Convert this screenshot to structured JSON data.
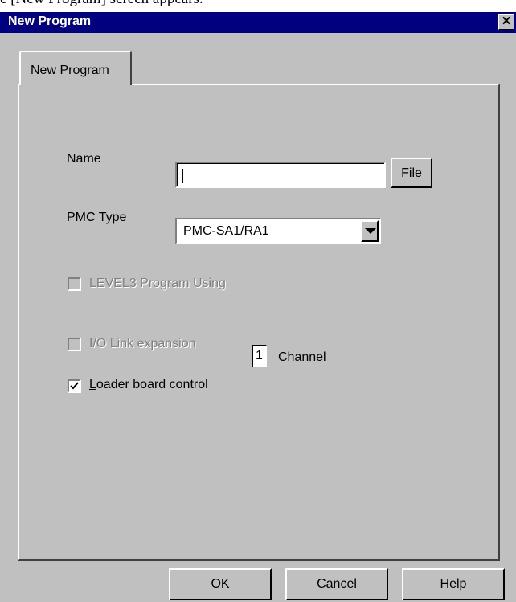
{
  "caption": "e [New Program] screen appears.",
  "window": {
    "title": "New Program",
    "close_glyph": "✕"
  },
  "tab": {
    "label": "New Program"
  },
  "form": {
    "name_label": "Name",
    "name_value": "",
    "file_button": "File",
    "pmc_type_label": "PMC Type",
    "pmc_type_value": "PMC-SA1/RA1",
    "level3": {
      "label": "LEVEL3 Program Using",
      "checked": false,
      "enabled": false
    },
    "io_link": {
      "label": "I/O Link expansion",
      "checked": false,
      "enabled": false,
      "channel_value": "1",
      "channel_label": "Channel"
    },
    "loader": {
      "label_access": "L",
      "label_rest": "oader board control",
      "checked": true,
      "enabled": true
    }
  },
  "buttons": {
    "ok": "OK",
    "cancel": "Cancel",
    "help": "Help"
  },
  "icons": {
    "close": "close-icon",
    "dropdown": "chevron-down-icon",
    "check": "check-icon"
  }
}
